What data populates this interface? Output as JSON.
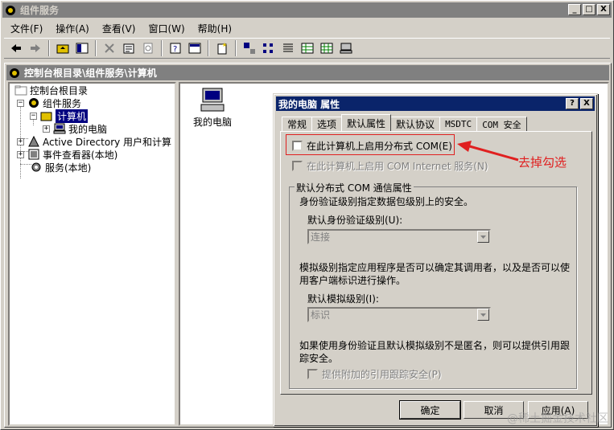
{
  "app": {
    "title": "组件服务"
  },
  "window_buttons": {
    "minimize": "_",
    "maximize": "□",
    "close": "X"
  },
  "menu": [
    {
      "label": "文件(F)"
    },
    {
      "label": "操作(A)"
    },
    {
      "label": "查看(V)"
    },
    {
      "label": "窗口(W)"
    },
    {
      "label": "帮助(H)"
    }
  ],
  "child_window": {
    "title": "控制台根目录\\组件服务\\计算机"
  },
  "tree": {
    "root": "控制台根目录",
    "component_services": "组件服务",
    "computers": "计算机",
    "my_computer": "我的电脑",
    "active_directory": "Active Directory 用户和计算",
    "event_viewer": "事件查看器(本地)",
    "services": "服务(本地)"
  },
  "list_view": {
    "my_computer_label": "我的电脑"
  },
  "dialog": {
    "title": "我的电脑 属性",
    "help_btn": "?",
    "close_btn": "X",
    "tabs": [
      {
        "label": "常规"
      },
      {
        "label": "选项"
      },
      {
        "label": "默认属性"
      },
      {
        "label": "默认协议"
      },
      {
        "label": "MSDTC"
      },
      {
        "label": "COM 安全"
      }
    ],
    "enable_dcom": "在此计算机上启用分布式 COM(E)",
    "enable_com_internet": "在此计算机上启用 COM Internet 服务(N)",
    "group_title": "默认分布式 COM 通信属性",
    "auth_desc": "身份验证级别指定数据包级别上的安全。",
    "auth_label": "默认身份验证级别(U):",
    "auth_value": "连接",
    "imp_desc": "模拟级别指定应用程序是否可以确定其调用者，以及是否可以使用客户端标识进行操作。",
    "imp_label": "默认模拟级别(I):",
    "imp_value": "标识",
    "ref_desc": "如果使用身份验证且默认模拟级别不是匿名，则可以提供引用跟踪安全。",
    "ref_check": "提供附加的引用跟踪安全(P)",
    "ok": "确定",
    "cancel": "取消",
    "apply": "应用(A)"
  },
  "annotation": {
    "text": "去掉勾选",
    "color": "#e02020"
  },
  "watermark": "@稀土掘金技术社区"
}
